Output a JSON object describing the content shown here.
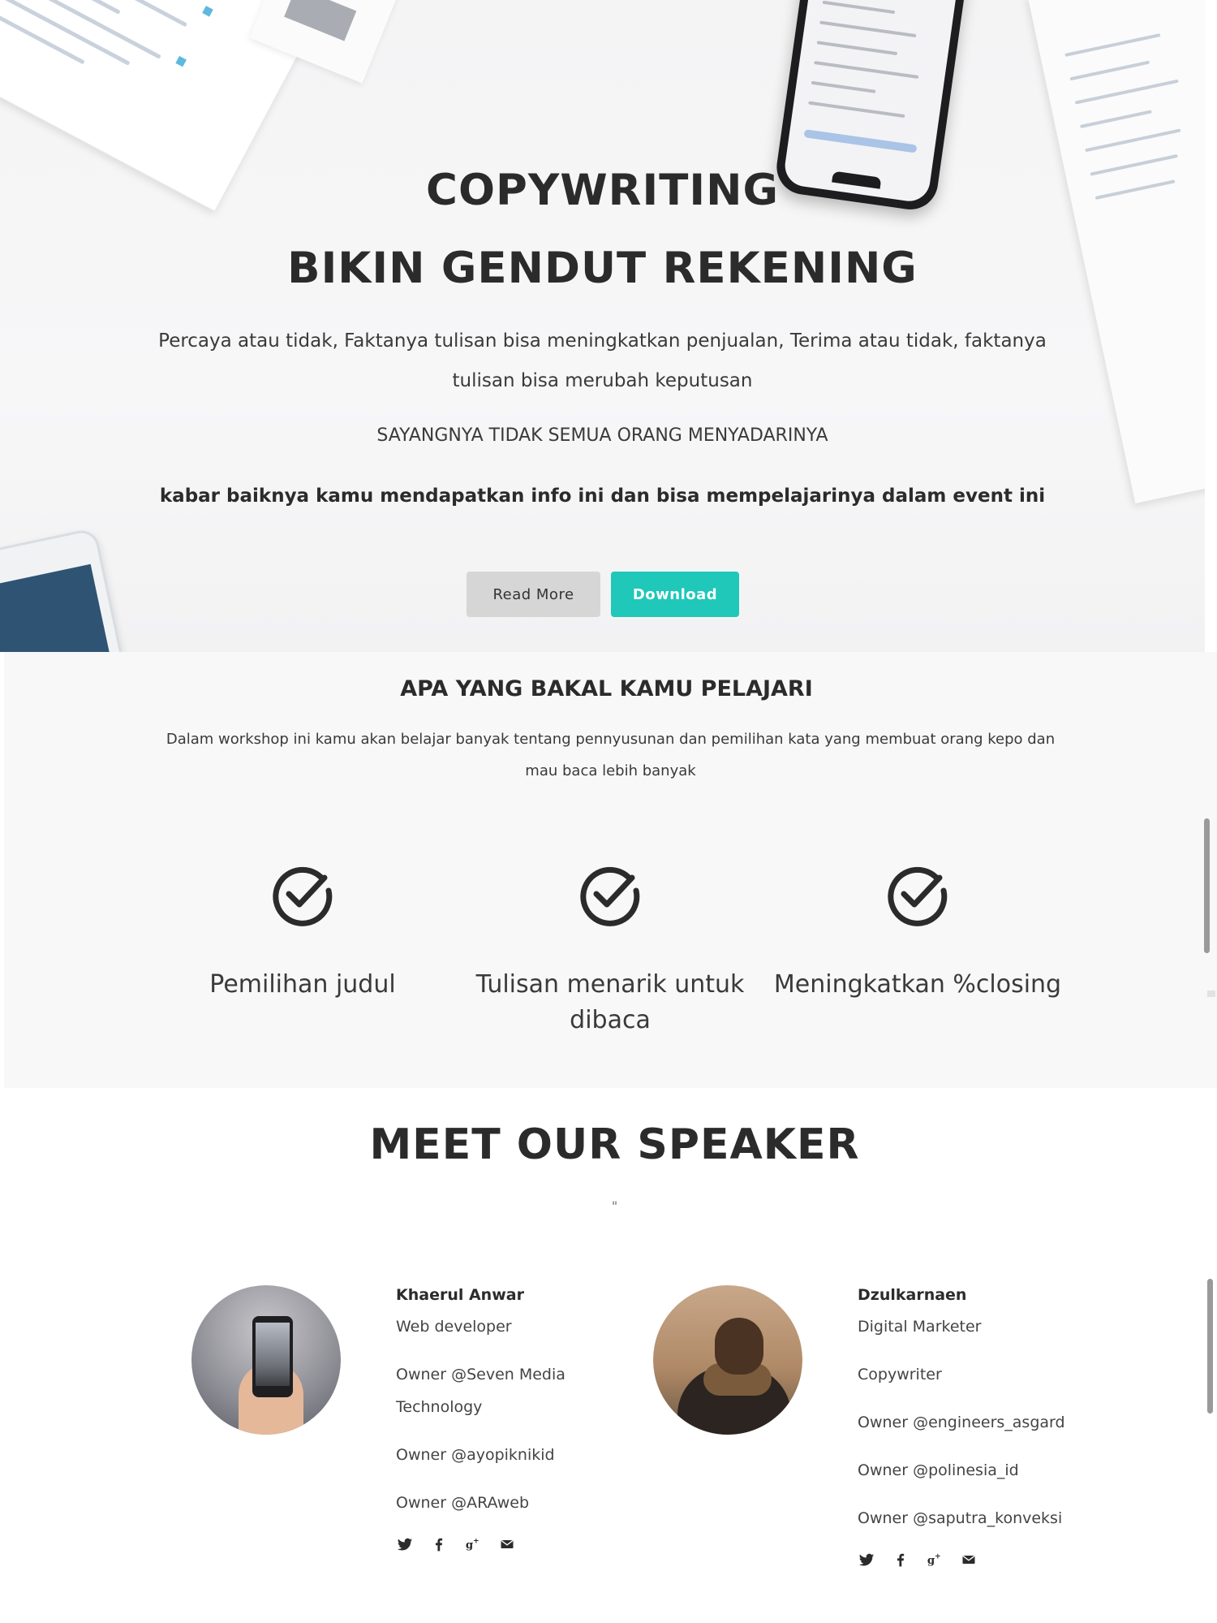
{
  "hero": {
    "title_line1": "COPYWRITING",
    "title_line2": "BIKIN GENDUT REKENING",
    "description": "Percaya atau tidak, Faktanya tulisan bisa meningkatkan penjualan, Terima atau tidak, faktanya tulisan bisa merubah keputusan",
    "warning": "SAYANGNYA TIDAK SEMUA ORANG MENYADARINYA",
    "good_news": "kabar baiknya kamu mendapatkan info ini dan bisa mempelajarinya dalam event ini",
    "read_more_label": "Read More",
    "download_label": "Download",
    "accent_color": "#1fc8b8"
  },
  "learn": {
    "title": "APA YANG BAKAL KAMU PELAJARI",
    "description": "Dalam workshop ini kamu akan belajar banyak tentang pennyusunan dan pemilihan kata yang membuat orang kepo dan mau baca lebih banyak",
    "features": [
      {
        "icon": "check-circle-icon",
        "label": "Pemilihan judul"
      },
      {
        "icon": "check-circle-icon",
        "label": "Tulisan menarik untuk dibaca"
      },
      {
        "icon": "check-circle-icon",
        "label": "Meningkatkan %closing"
      }
    ]
  },
  "speakers": {
    "title": "MEET OUR SPEAKER",
    "quote": "\"",
    "people": [
      {
        "name": "Khaerul Anwar",
        "lines": [
          "Web developer",
          "Owner @Seven Media Technology",
          "Owner @ayopiknikid",
          "Owner @ARAweb"
        ],
        "socials": [
          "twitter-icon",
          "facebook-icon",
          "google-plus-icon",
          "email-icon"
        ]
      },
      {
        "name": "Dzulkarnaen",
        "lines": [
          "Digital Marketer",
          "Copywriter",
          "Owner @engineers_asgard",
          "Owner @polinesia_id",
          "Owner @saputra_konveksi"
        ],
        "socials": [
          "twitter-icon",
          "facebook-icon",
          "google-plus-icon",
          "email-icon"
        ]
      }
    ]
  }
}
